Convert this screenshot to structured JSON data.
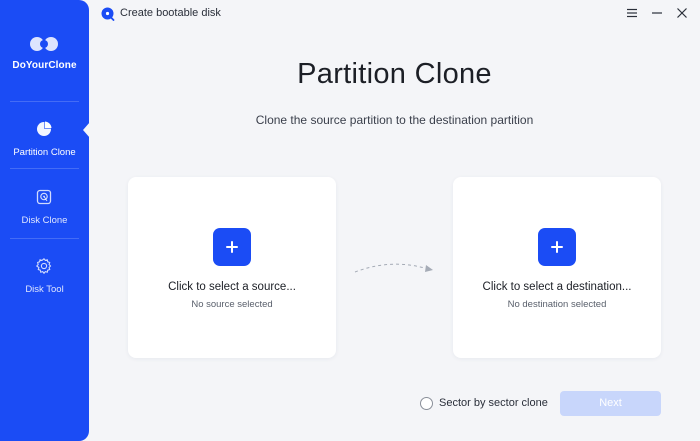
{
  "app": {
    "name": "DoYourClone",
    "window_title": "Create bootable disk",
    "accent_color": "#1b4cf5"
  },
  "sidebar": {
    "items": [
      {
        "label": "Partition Clone",
        "icon": "pie-chart-icon",
        "active": true
      },
      {
        "label": "Disk Clone",
        "icon": "disk-icon",
        "active": false
      },
      {
        "label": "Disk Tool",
        "icon": "gear-icon",
        "active": false
      }
    ]
  },
  "titlebar": {
    "buttons": [
      "menu-icon",
      "minimize-icon",
      "close-icon"
    ]
  },
  "main": {
    "title": "Partition Clone",
    "subtitle": "Clone the source partition to the destination partition",
    "source": {
      "title": "Click to select a source...",
      "status": "No source selected"
    },
    "destination": {
      "title": "Click to select a destination...",
      "status": "No destination selected"
    },
    "sector_option": "Sector by sector clone",
    "sector_checked": false,
    "next_label": "Next",
    "next_enabled": false
  }
}
